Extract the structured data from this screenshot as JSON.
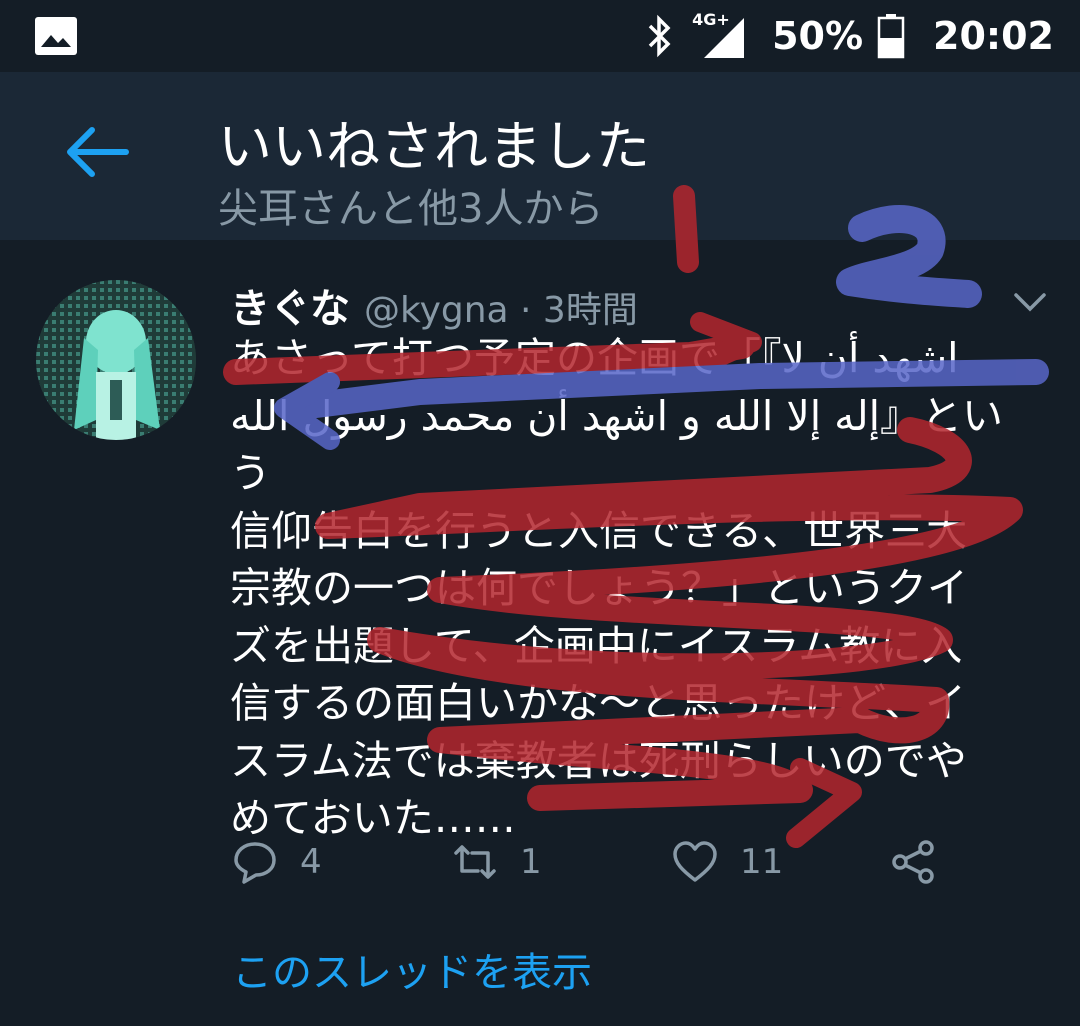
{
  "status_bar": {
    "network": "4G+",
    "battery": "50%",
    "time": "20:02"
  },
  "header": {
    "title": "いいねされました",
    "subtitle": "尖耳さんと他3人から"
  },
  "tweet": {
    "name": "きぐな",
    "handle": "@kygna · 3時間",
    "text": "あさって打つ予定の企画で「『اشهد أن لا\nإله إلا الله و اشهد أن محمد رسول الله』という\n信仰告白を行うと入信できる、世界三大\n宗教の一つは何でしょう？」というクイ\nズを出題して、企画中にイスラム教に入\n信するの面白いかな～と思ったけど、イ\nスラム法では棄教者は死刑らしいのでや\nめておいた……",
    "reply_count": "4",
    "retweet_count": "1",
    "like_count": "11"
  },
  "thread_link": "このスレッドを表示",
  "colors": {
    "background": "#141d26",
    "header": "#1b2836",
    "accent": "#1da1f2",
    "muted": "#8899a6",
    "scribble_red": "#b3262e",
    "scribble_blue": "#5866c8"
  }
}
